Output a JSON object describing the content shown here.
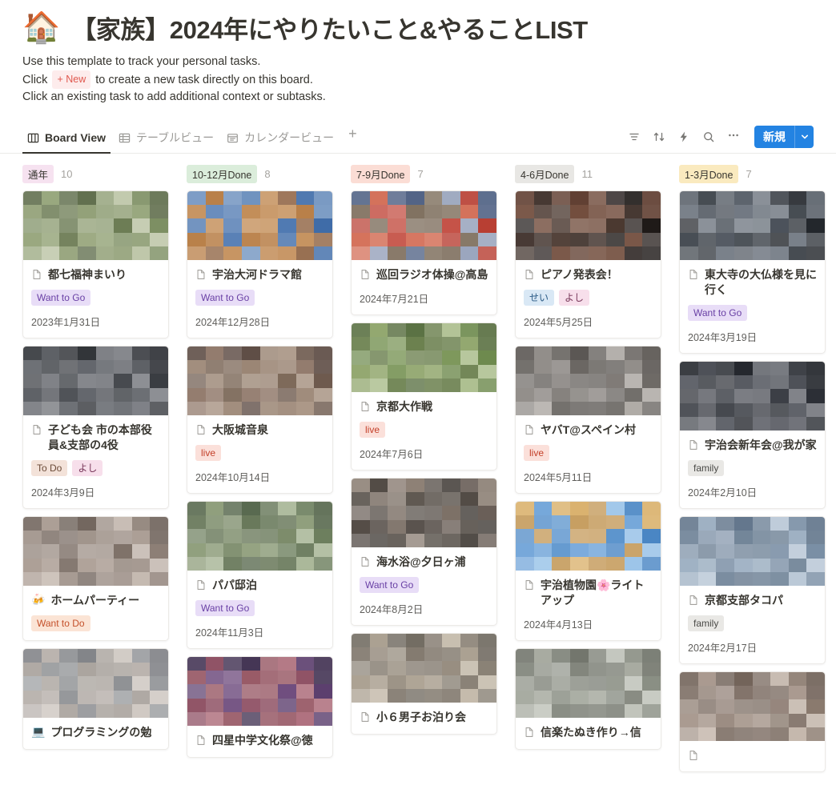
{
  "header": {
    "emoji": "🏠",
    "title": "【家族】2024年にやりたいこと&やることLIST",
    "desc_line1": "Use this template to track your personal tasks.",
    "desc_line2_pre": "Click",
    "new_chip": "+ New",
    "desc_line2_post": "to create a new task directly on this board.",
    "desc_line3": "Click an existing task to add additional context or subtasks."
  },
  "views": {
    "tabs": [
      {
        "label": "Board View",
        "icon": "board-icon",
        "active": true
      },
      {
        "label": "テーブルビュー",
        "icon": "table-icon",
        "active": false
      },
      {
        "label": "カレンダービュー",
        "icon": "calendar-icon",
        "active": false
      }
    ],
    "add_view": "+"
  },
  "toolbar": {
    "filter_icon": "filter-icon",
    "sort_icon": "sort-icon",
    "automation_icon": "lightning-icon",
    "search_icon": "search-icon",
    "more_icon": "more-options-icon",
    "new_label": "新規",
    "new_caret_icon": "chevron-down-icon",
    "accent_color": "#2383e2"
  },
  "board": {
    "columns": [
      {
        "name": "通年",
        "count": "10",
        "chip_bg": "#f6e2f0",
        "cover_colors": [
          "#8a9c6e",
          "#6e7f55",
          "#a8b38c",
          "#5e6b4a"
        ],
        "cards": [
          {
            "icon": "document-icon",
            "emoji": "",
            "title": "都七福神まいり",
            "tags": [
              {
                "label": "Want to Go",
                "bg": "#e8ddf7",
                "fg": "#6940a5"
              }
            ],
            "date": "2023年1月31日",
            "cover": [
              "#7d8f63",
              "#94a378",
              "#5d6b49",
              "#b6bf9e",
              "#6a7a52",
              "#8d9c72"
            ]
          },
          {
            "icon": "document-icon",
            "emoji": "",
            "title": "子ども会 市の本部役員&支部の4役",
            "tags": [
              {
                "label": "To Do",
                "bg": "#f3e2d9",
                "fg": "#6b4b38"
              },
              {
                "label": "よし",
                "bg": "#f7dfeb",
                "fg": "#7a3a5c"
              }
            ],
            "date": "2024年3月9日",
            "cover": [
              "#3a3d42",
              "#55585e",
              "#2b2e33",
              "#6d7076",
              "#43464b",
              "#5c5f65"
            ]
          },
          {
            "icon": "emoji",
            "emoji": "🍻",
            "title": "ホームパーティー",
            "tags": [
              {
                "label": "Want to Do",
                "bg": "#fbe4d5",
                "fg": "#c4502a"
              }
            ],
            "date": "",
            "cover": [
              "#8d7f76",
              "#a89a90",
              "#6e625a",
              "#bdb0a6",
              "#7c6f66",
              "#9c8f86"
            ]
          },
          {
            "icon": "emoji",
            "emoji": "💻",
            "title": "プログラミングの勉",
            "tags": [],
            "date": "",
            "cover": [
              "#9a9c9f",
              "#b7b0ab",
              "#7f8185",
              "#c9c2bb",
              "#8e9093",
              "#a6a09a"
            ]
          }
        ]
      },
      {
        "name": "10-12月Done",
        "count": "8",
        "chip_bg": "#dbeddb",
        "cover_colors": [
          "#4a6fa5",
          "#c98a5a",
          "#8f6b52",
          "#5f86b8"
        ],
        "cards": [
          {
            "icon": "document-icon",
            "emoji": "",
            "title": "宇治大河ドラマ館",
            "tags": [
              {
                "label": "Want to Go",
                "bg": "#e8ddf7",
                "fg": "#6940a5"
              }
            ],
            "date": "2024年12月28日",
            "cover": [
              "#3f6ca8",
              "#b5793f",
              "#6b8fbd",
              "#8a5c3a",
              "#4d77b0",
              "#c08850"
            ]
          },
          {
            "icon": "document-icon",
            "emoji": "",
            "title": "大阪城音泉",
            "tags": [
              {
                "label": "live",
                "bg": "#fbe0da",
                "fg": "#c4402a"
              }
            ],
            "date": "2024年10月14日",
            "cover": [
              "#6e5a4e",
              "#8d7566",
              "#5a4840",
              "#a08a78",
              "#7b6757",
              "#96806e"
            ]
          },
          {
            "icon": "document-icon",
            "emoji": "",
            "title": "パパ邸泊",
            "tags": [
              {
                "label": "Want to Go",
                "bg": "#e8ddf7",
                "fg": "#6940a5"
              }
            ],
            "date": "2024年11月3日",
            "cover": [
              "#6d7f5e",
              "#8a9a76",
              "#54654a",
              "#9fae8c",
              "#7a8a68",
              "#617252"
            ]
          },
          {
            "icon": "document-icon",
            "emoji": "",
            "title": "四星中学文化祭@徳",
            "tags": [],
            "date": "",
            "cover": [
              "#5c3f6e",
              "#8a4a5e",
              "#3f2f50",
              "#a55f6e",
              "#6d4a7c",
              "#93525f"
            ]
          }
        ]
      },
      {
        "name": "7-9月Done",
        "count": "7",
        "chip_bg": "#fbddd5",
        "cover_colors": [
          "#c0463a",
          "#5a6a8a",
          "#8a9c6e",
          "#b8a070"
        ],
        "cards": [
          {
            "icon": "document-icon",
            "emoji": "",
            "title": "巡回ラジオ体操@高島",
            "tags": [],
            "date": "2024年7月21日",
            "cover": [
              "#b83f33",
              "#d26a52",
              "#4d5f82",
              "#8d9ab5",
              "#c45044",
              "#7a6a58"
            ]
          },
          {
            "icon": "document-icon",
            "emoji": "",
            "title": "京都大作戦",
            "tags": [
              {
                "label": "live",
                "bg": "#fbe0da",
                "fg": "#c4402a"
              }
            ],
            "date": "2024年7月6日",
            "cover": [
              "#6e8a4e",
              "#8da368",
              "#566d3e",
              "#a3b782",
              "#7b9659",
              "#647a46"
            ]
          },
          {
            "icon": "document-icon",
            "emoji": "",
            "title": "海水浴@夕日ヶ浦",
            "tags": [
              {
                "label": "Want to Go",
                "bg": "#e8ddf7",
                "fg": "#6940a5"
              }
            ],
            "date": "2024年8月2日",
            "cover": [
              "#6a5f58",
              "#4a423c",
              "#8a7d72",
              "#3a342f",
              "#7a6e64",
              "#575049"
            ]
          },
          {
            "icon": "document-icon",
            "emoji": "",
            "title": "小６男子お泊り会",
            "tags": [],
            "date": "",
            "cover": [
              "#8a8276",
              "#a79c8c",
              "#6e685e",
              "#bdb2a0",
              "#968c7e",
              "#7d7468"
            ]
          }
        ]
      },
      {
        "name": "4-6月Done",
        "count": "11",
        "chip_bg": "#e8e7e4",
        "cover_colors": [
          "#2e2522",
          "#7a3a2a",
          "#4a3026",
          "#8f5a3e"
        ],
        "cards": [
          {
            "icon": "document-icon",
            "emoji": "",
            "title": "ピアノ発表会！",
            "tags": [
              {
                "label": "せい",
                "bg": "#d9e8f5",
                "fg": "#2a5a85"
              },
              {
                "label": "よし",
                "bg": "#f7dfeb",
                "fg": "#7a3a5c"
              }
            ],
            "date": "2024年5月25日",
            "cover": [
              "#1f1a18",
              "#3d2e28",
              "#5c3a2c",
              "#2a2220",
              "#47352c",
              "#6b4534"
            ]
          },
          {
            "icon": "document-icon",
            "emoji": "",
            "title": "ヤバT@スペイン村",
            "tags": [
              {
                "label": "live",
                "bg": "#fbe0da",
                "fg": "#c4402a"
              }
            ],
            "date": "2024年5月11日",
            "cover": [
              "#6e6a66",
              "#8c8884",
              "#56524e",
              "#a5a09b",
              "#7d7874",
              "#635f5b"
            ]
          },
          {
            "icon": "document-icon",
            "emoji": "",
            "title": "宇治植物園🌸ライトアップ",
            "tags": [],
            "date": "2024年4月13日",
            "cover": [
              "#4a86c4",
              "#6fa3d8",
              "#d9b06a",
              "#8fbde6",
              "#5a93cc",
              "#c49a5a"
            ]
          },
          {
            "icon": "document-icon",
            "emoji": "",
            "title": "信楽たぬき作り→信",
            "tags": [],
            "date": "",
            "cover": [
              "#8a8f84",
              "#a3a79c",
              "#6e7268",
              "#b8bcb2",
              "#969a90",
              "#7c8076"
            ]
          }
        ]
      },
      {
        "name": "1-3月Done",
        "count": "7",
        "chip_bg": "#faeabf",
        "cover_colors": [
          "#2a2e33",
          "#4a5159",
          "#6a737d",
          "#3a4149"
        ],
        "cards": [
          {
            "icon": "document-icon",
            "emoji": "",
            "title": "東大寺の大仏様を見に行く",
            "tags": [
              {
                "label": "Want to Go",
                "bg": "#e8ddf7",
                "fg": "#6940a5"
              }
            ],
            "date": "2024年3月19日",
            "cover": [
              "#23272c",
              "#3d434a",
              "#585f68",
              "#2e333a",
              "#484f58",
              "#6a727c"
            ]
          },
          {
            "icon": "document-icon",
            "emoji": "",
            "title": "宇治会新年会@我が家",
            "tags": [
              {
                "label": "family",
                "bg": "#e9e8e5",
                "fg": "#4a4a47"
              }
            ],
            "date": "2024年2月10日",
            "cover": [
              "#2c2f36",
              "#45484f",
              "#1e2127",
              "#5d6068",
              "#383b42",
              "#4f525a"
            ]
          },
          {
            "icon": "document-icon",
            "emoji": "",
            "title": "京都支部タコパ",
            "tags": [
              {
                "label": "family",
                "bg": "#e9e8e5",
                "fg": "#4a4a47"
              }
            ],
            "date": "2024年2月17日",
            "cover": [
              "#7a8fa5",
              "#9aadc0",
              "#5f7389",
              "#b2c2d2",
              "#8799ad",
              "#6b7f94"
            ]
          },
          {
            "icon": "document-icon",
            "emoji": "",
            "title": "",
            "tags": [],
            "date": "",
            "cover": [
              "#8a7a6e",
              "#a5958a",
              "#6e5f55",
              "#bdaea2",
              "#94847a",
              "#7c6d63"
            ]
          }
        ]
      }
    ]
  }
}
